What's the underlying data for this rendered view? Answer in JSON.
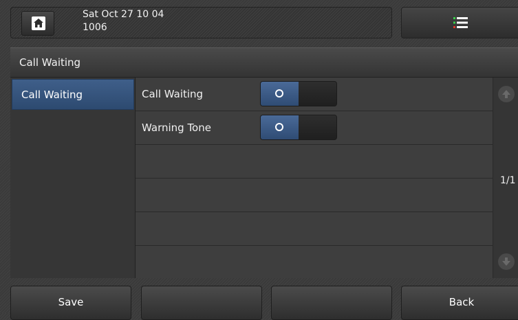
{
  "status": {
    "datetime": "Sat Oct 27 10 04",
    "extension": "1006"
  },
  "icons": {
    "home": "home-icon",
    "menu": "menu-icon",
    "up": "scroll-up-icon",
    "down": "scroll-down-icon"
  },
  "title": "Call Waiting",
  "sidebar": {
    "items": [
      {
        "label": "Call Waiting",
        "selected": true
      }
    ]
  },
  "settings": [
    {
      "label": "Call Waiting",
      "value": "Off"
    },
    {
      "label": "Warning Tone",
      "value": "Off"
    }
  ],
  "pager": {
    "indicator": "1/1"
  },
  "softkeys": [
    {
      "label": "Save"
    },
    {
      "label": ""
    },
    {
      "label": ""
    },
    {
      "label": "Back"
    }
  ],
  "colors": {
    "accent": "#3a5a86",
    "menu_dot_green": "#3bd14a",
    "menu_dot_red": "#e03a2a"
  }
}
